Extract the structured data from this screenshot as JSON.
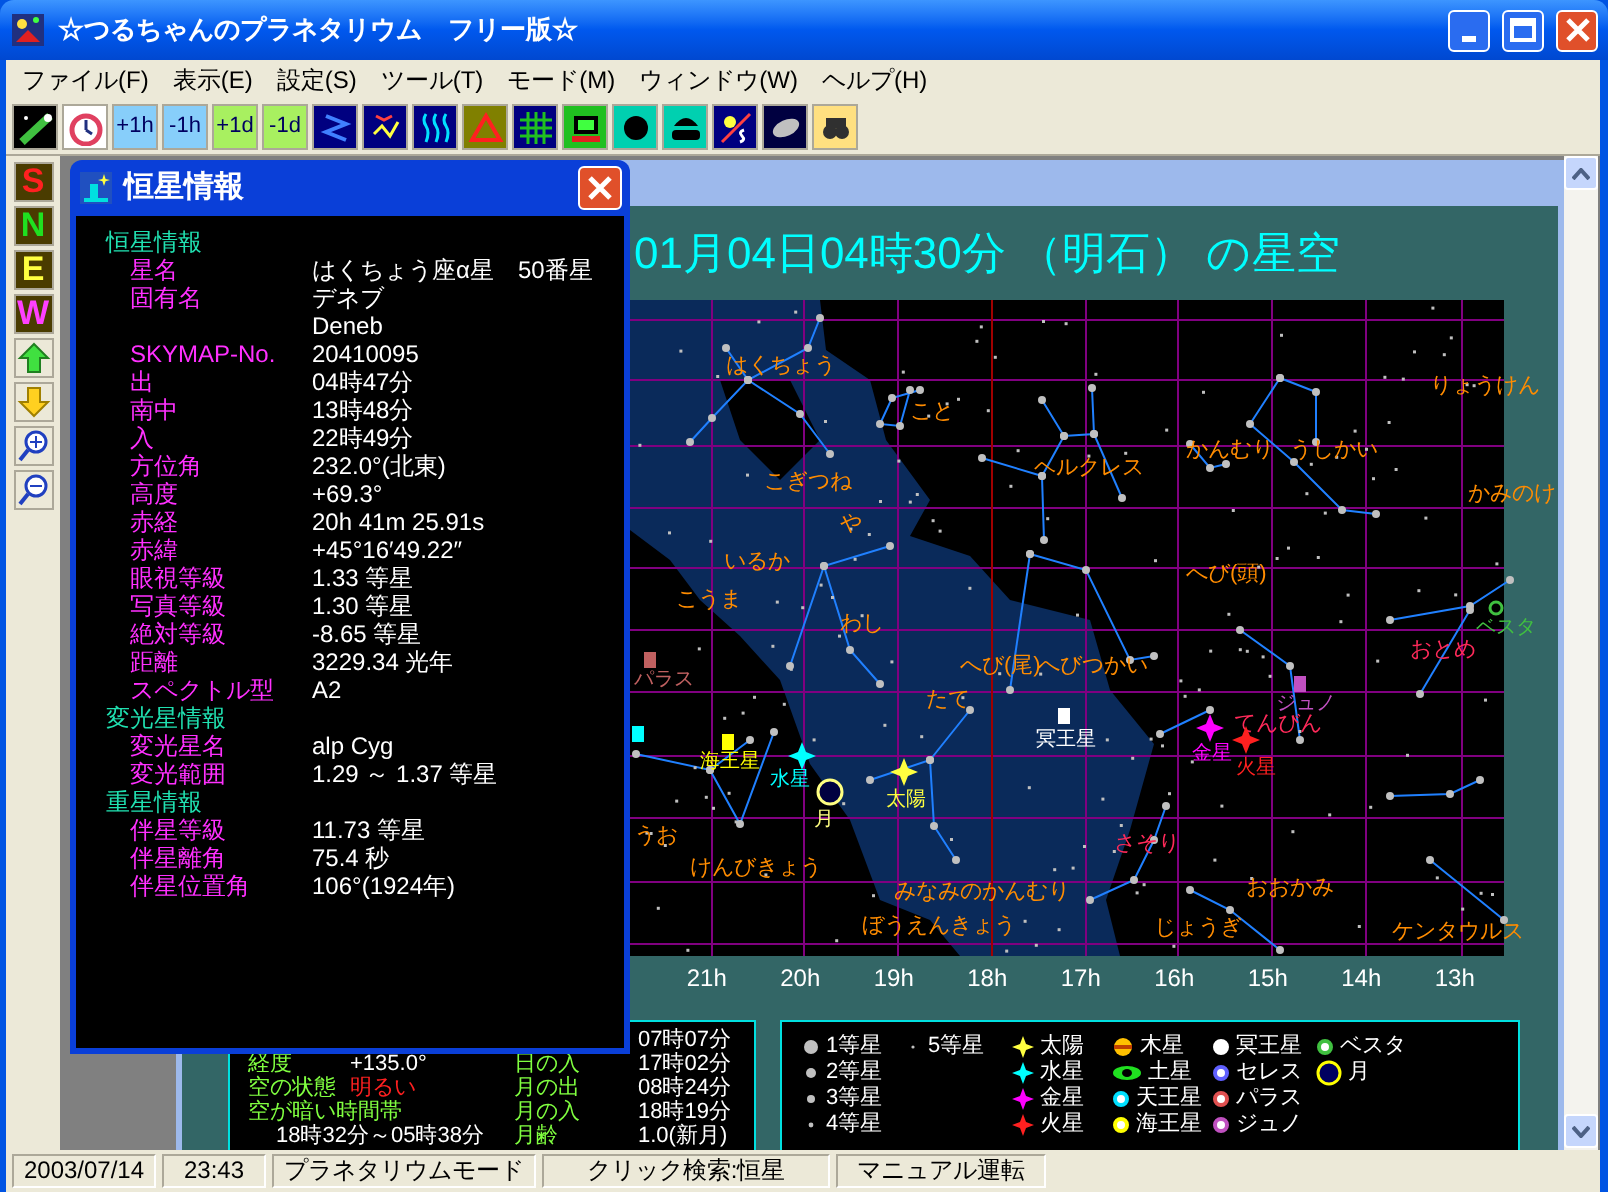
{
  "window": {
    "title": "☆つるちゃんのプラネタリウム　フリー版☆"
  },
  "menu": [
    "ファイル(F)",
    "表示(E)",
    "設定(S)",
    "ツール(T)",
    "モード(M)",
    "ウィンドウ(W)",
    "ヘルプ(H)"
  ],
  "toolbar": {
    "time_buttons": [
      "+1h",
      "-1h",
      "+1d",
      "-1d"
    ]
  },
  "direction_buttons": [
    "S",
    "N",
    "E",
    "W"
  ],
  "star_info_window": {
    "title": "恒星情報",
    "sections": [
      {
        "heading": "恒星情報",
        "rows": [
          {
            "label": "星名",
            "value": "はくちょう座α星　50番星"
          },
          {
            "label": "固有名",
            "value": "デネブ"
          },
          {
            "value": "Deneb"
          },
          {
            "label": "SKYMAP-No.",
            "value": "20410095"
          },
          {
            "label": "出",
            "value": "04時47分"
          },
          {
            "label": "南中",
            "value": "13時48分"
          },
          {
            "label": "入",
            "value": "22時49分"
          },
          {
            "label": "方位角",
            "value": "232.0°(北東)"
          },
          {
            "label": "高度",
            "value": "+69.3°"
          },
          {
            "label": "赤経",
            "value": "20h 41m 25.91s"
          },
          {
            "label": "赤緯",
            "value": "+45°16′49.22″"
          },
          {
            "label": "眼視等級",
            "value": "1.33 等星"
          },
          {
            "label": "写真等級",
            "value": "1.30 等星"
          },
          {
            "label": "絶対等級",
            "value": "-8.65 等星"
          },
          {
            "label": "距離",
            "value": "3229.34 光年"
          },
          {
            "label": "スペクトル型",
            "value": "A2"
          }
        ]
      },
      {
        "heading": "変光星情報",
        "rows": [
          {
            "label": "変光星名",
            "value": "alp Cyg"
          },
          {
            "label": "変光範囲",
            "value": "1.29 ～ 1.37 等星"
          }
        ]
      },
      {
        "heading": "重星情報",
        "rows": [
          {
            "label": "伴星等級",
            "value": "11.73 等星"
          },
          {
            "label": "伴星離角",
            "value": "75.4 秒"
          },
          {
            "label": "伴星位置角",
            "value": "106°(1924年)"
          }
        ]
      }
    ]
  },
  "planetarium_window": {
    "heading": "01月04日04時30分 （明石） の星空",
    "sky_map": {
      "constellations": [
        {
          "name": "はくちょう",
          "color": "#ff8c00"
        },
        {
          "name": "こと",
          "color": "#ff8c00"
        },
        {
          "name": "こぎつね",
          "color": "#ff8c00"
        },
        {
          "name": "や",
          "color": "#ff8c00"
        },
        {
          "name": "いるか",
          "color": "#ff8c00"
        },
        {
          "name": "ヘルクレス",
          "color": "#ff8c00"
        },
        {
          "name": "かんむり",
          "color": "#ff8c00"
        },
        {
          "name": "うしかい",
          "color": "#ff8c00"
        },
        {
          "name": "りょうけん",
          "color": "#ff8c00"
        },
        {
          "name": "かみのけ",
          "color": "#ff8c00"
        },
        {
          "name": "へび(頭)",
          "color": "#ff8c00"
        },
        {
          "name": "こうま",
          "color": "#ff8c00"
        },
        {
          "name": "わし",
          "color": "#ff8c00"
        },
        {
          "name": "へび(尾)",
          "color": "#ff8c00"
        },
        {
          "name": "へびつかい",
          "color": "#ff8c00"
        },
        {
          "name": "たて",
          "color": "#ff8c00"
        },
        {
          "name": "てんびん",
          "color": "#ff2a5a"
        },
        {
          "name": "おとめ",
          "color": "#ff2a5a"
        },
        {
          "name": "うお",
          "color": "#ff8c00"
        },
        {
          "name": "けんびきょう",
          "color": "#ff8c00"
        },
        {
          "name": "みなみのかんむり",
          "color": "#ff8c00"
        },
        {
          "name": "さそり",
          "color": "#ff2a5a"
        },
        {
          "name": "おおかみ",
          "color": "#ff8c00"
        },
        {
          "name": "ぼうえんきょう",
          "color": "#ff8c00"
        },
        {
          "name": "じょうぎ",
          "color": "#ff8c00"
        },
        {
          "name": "ケンタウルス",
          "color": "#ff8c00"
        }
      ],
      "bodies": [
        {
          "name": "冥王星",
          "kind": "square",
          "color": "#ffffff"
        },
        {
          "name": "ジュノ",
          "kind": "square",
          "color": "#c050c0"
        },
        {
          "name": "ベスタ",
          "kind": "ring",
          "color": "#40c040"
        },
        {
          "name": "パラス",
          "kind": "square",
          "color": "#c06060"
        },
        {
          "name": "金星",
          "kind": "spark",
          "color": "#ff00ff"
        },
        {
          "name": "火星",
          "kind": "spark",
          "color": "#ff2020"
        },
        {
          "name": "海王星",
          "kind": "square",
          "color": "#ffff00"
        },
        {
          "name": "水星",
          "kind": "spark",
          "color": "#00ffff"
        },
        {
          "name": "太陽",
          "kind": "spark",
          "color": "#ffff40"
        },
        {
          "name": "月",
          "kind": "moon",
          "color": "#ffff80"
        },
        {
          "kind": "square",
          "color": "#00ffff"
        }
      ],
      "hour_labels": [
        "21h",
        "20h",
        "19h",
        "18h",
        "17h",
        "16h",
        "15h",
        "14h",
        "13h"
      ]
    },
    "sky_panel": {
      "rows": [
        {
          "value_2": "07時07分",
          "warning": false
        },
        {
          "label_1": "経度",
          "value_1": "+135.0°",
          "label_2": "日の入",
          "value_2": "17時02分",
          "warning": false
        },
        {
          "label_1": "空の状態",
          "value_1": "明るい",
          "label_2": "月の出",
          "value_2": "08時24分",
          "warning": true
        },
        {
          "label_1": "空が暗い時間帯",
          "label_2": "月の入",
          "value_2": "18時19分",
          "warning": false
        },
        {
          "value_1": "18時32分～05時38分",
          "label_2": "月齢",
          "value_2": "1.0(新月)",
          "warning": false
        }
      ]
    },
    "legend": [
      [
        {
          "label": "1等星",
          "kind": "star"
        },
        {
          "label": "2等星",
          "kind": "star"
        },
        {
          "label": "3等星",
          "kind": "star"
        },
        {
          "label": "4等星",
          "kind": "star"
        }
      ],
      [
        {
          "label": "5等星",
          "kind": "star"
        }
      ],
      [
        {
          "label": "太陽",
          "kind": "spark",
          "color": "#ffff40"
        },
        {
          "label": "水星",
          "kind": "spark",
          "color": "#00ffff"
        },
        {
          "label": "金星",
          "kind": "spark",
          "color": "#ff00ff"
        },
        {
          "label": "火星",
          "kind": "spark",
          "color": "#ff2020"
        }
      ],
      [
        {
          "label": "木星",
          "kind": "disc",
          "color": "#ffc000"
        },
        {
          "label": "土星",
          "kind": "saturn",
          "color": "#20e020"
        },
        {
          "label": "天王星",
          "kind": "ring",
          "color": "#00e0ff"
        },
        {
          "label": "海王星",
          "kind": "ring",
          "color": "#ffff00"
        }
      ],
      [
        {
          "label": "冥王星",
          "kind": "ring",
          "color": "#ffffff"
        },
        {
          "label": "セレス",
          "kind": "ring",
          "color": "#6060ff"
        },
        {
          "label": "パラス",
          "kind": "ring",
          "color": "#e05050"
        },
        {
          "label": "ジュノ",
          "kind": "ring",
          "color": "#c050c0"
        }
      ],
      [
        {
          "label": "ベスタ",
          "kind": "ring",
          "color": "#40c040"
        },
        {
          "label": "月",
          "kind": "moon",
          "color": "#ffff00"
        }
      ]
    ]
  },
  "status_bar": [
    "2003/07/14",
    "23:43",
    "プラネタリウムモード",
    "クリック検索:恒星",
    "マニュアル運転"
  ]
}
